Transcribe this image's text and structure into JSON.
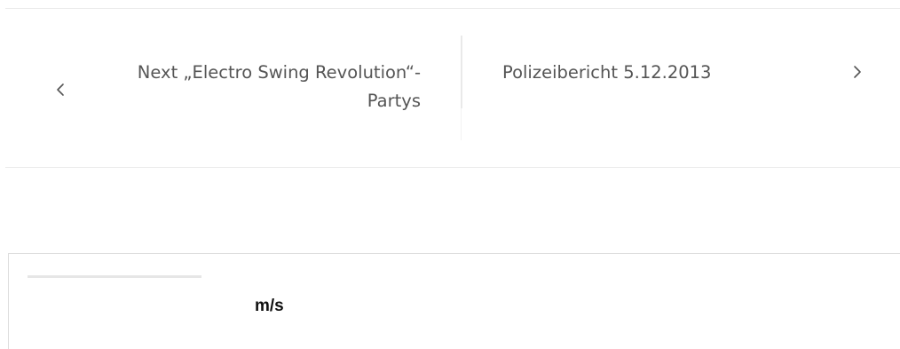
{
  "post_navigation": {
    "previous": {
      "label": "Next „Electro Swing Revolution“-Partys",
      "icon": "chevron-left-icon"
    },
    "next": {
      "label": "Polizeibericht 5.12.2013",
      "icon": "chevron-right-icon"
    }
  },
  "widget": {
    "unit_label": "m/s"
  },
  "colors": {
    "text": "#555555",
    "divider": "#ebebeb",
    "unit_text": "#111111"
  }
}
